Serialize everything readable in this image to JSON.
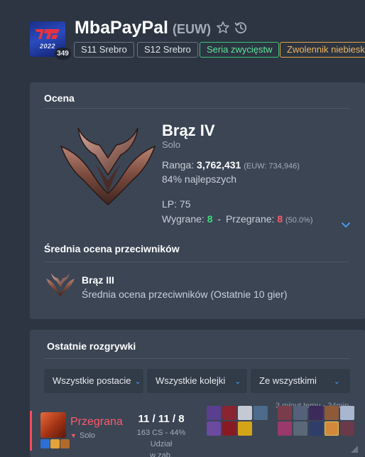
{
  "profile": {
    "name": "MbaPayPal",
    "region": "(EUW)",
    "level": "349",
    "avatar_year": "2022",
    "tags": [
      "S11 Srebro",
      "S12 Srebro",
      "Seria zwycięstw",
      "Zwolennik niebieskiej strony"
    ],
    "icons": [
      "star-icon",
      "history-icon"
    ]
  },
  "rating": {
    "title": "Ocena",
    "rank": "Brąz IV",
    "queue": "Solo",
    "ranga_label": "Ranga:",
    "ranga_value": "3,762,431",
    "ranga_region": "(EUW: 734,946)",
    "percentile": "84% najlepszych",
    "lp": "LP: 75",
    "wins_label": "Wygrane:",
    "wins": "8",
    "separator": "-",
    "losses_label": "Przegrane:",
    "losses": "8",
    "winrate": "(50.0%)",
    "avg_title": "Średnia ocena przeciwników",
    "avg_rank": "Brąz III",
    "avg_desc": "Średnia ocena przeciwników (Ostatnie 10 gier)"
  },
  "games": {
    "title": "Ostatnie rozgrywki",
    "filters": [
      "Wszystkie postacie",
      "Wszystkie kolejki",
      "Ze wszystkimi"
    ],
    "match": {
      "meta": "3 minut temu - 34min...",
      "result": "Przegrana",
      "queue": "Solo",
      "kda": "11 / 11 / 8",
      "cs": "163 CS - 44% Udział",
      "cs2": "w zab."
    }
  },
  "colors": {
    "background": "#2c3541",
    "panel": "#3b4554",
    "win": "#3ddb7e",
    "loss": "#ff5a6a",
    "accent": "#4aa3ff",
    "streak": "#3fc37c",
    "blue_side": "#e6a34a"
  }
}
